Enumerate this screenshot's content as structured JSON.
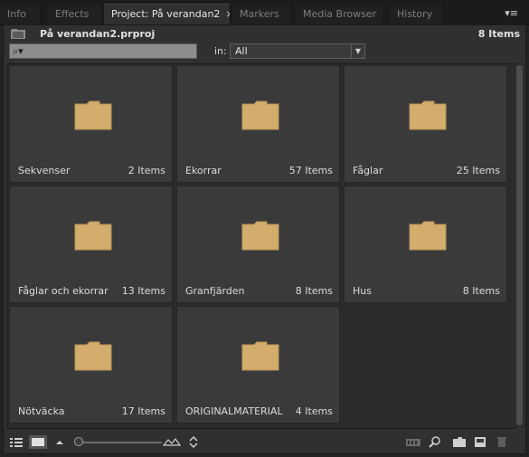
{
  "tabs": [
    {
      "label": "Info"
    },
    {
      "label": "Effects"
    },
    {
      "label": "Project: På verandan2",
      "close": "×"
    },
    {
      "label": "Markers"
    },
    {
      "label": "Media Browser"
    },
    {
      "label": "History"
    }
  ],
  "panel_menu": "▾≡",
  "project": {
    "file_name": "På verandan2.prproj",
    "item_count": "8 Items"
  },
  "search": {
    "icon": "⌕▾",
    "value": "",
    "in_label": "in:",
    "in_value": "All",
    "in_arrow": "▼"
  },
  "bins": [
    {
      "name": "Sekvenser",
      "count": "2 Items"
    },
    {
      "name": "Ekorrar",
      "count": "57 Items"
    },
    {
      "name": "Fåglar",
      "count": "25 Items"
    },
    {
      "name": "Fåglar och ekorrar",
      "count": "13 Items"
    },
    {
      "name": "Granfjärden",
      "count": "8 Items"
    },
    {
      "name": "Hus",
      "count": "8 Items"
    },
    {
      "name": "Nötväcka",
      "count": "17 Items"
    },
    {
      "name": "ORIGINALMATERIAL",
      "count": "4 Items"
    }
  ],
  "colors": {
    "folder": "#d2ad6b",
    "folder_dark": "#b8945a"
  },
  "icons": [
    "list-view-icon",
    "icon-view-icon",
    "zoom-out-icon",
    "zoom-in-icon",
    "sort-icon",
    "automate-icon",
    "find-icon",
    "new-bin-icon",
    "new-item-icon",
    "trash-icon"
  ]
}
